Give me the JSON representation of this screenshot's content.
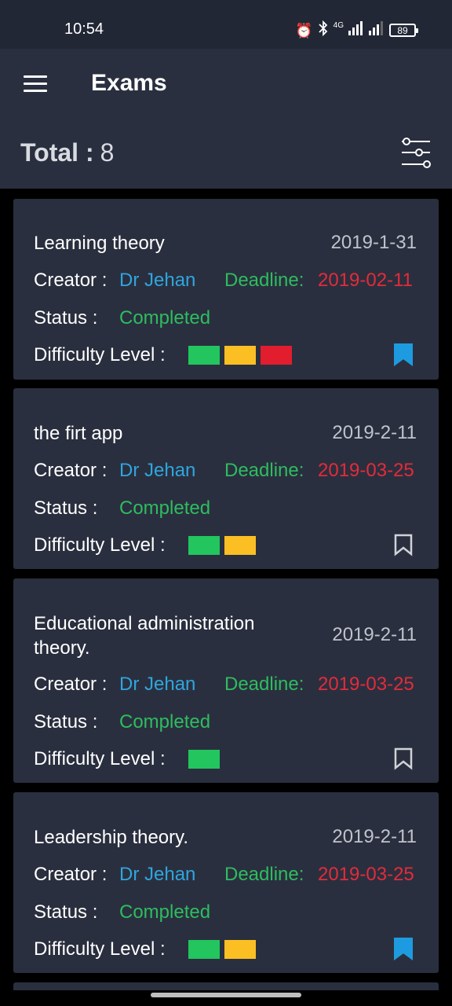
{
  "status_bar": {
    "time": "10:54",
    "network": "4G",
    "battery": "89",
    "icons": [
      "alarm-icon",
      "bluetooth-icon",
      "signal-icon",
      "signal-icon",
      "battery-icon"
    ]
  },
  "header": {
    "title": "Exams",
    "total_label": "Total :",
    "total_value": "8"
  },
  "labels": {
    "creator": "Creator :",
    "deadline": "Deadline:",
    "status": "Status :",
    "difficulty": "Difficulty Level :"
  },
  "colors": {
    "green": "#22c55e",
    "orange": "#fbbf24",
    "red": "#e11d2e",
    "bookmark_active": "#1e9be0",
    "bookmark_inactive": "#cfd2d8"
  },
  "exams": [
    {
      "title": "Learning theory",
      "date": "2019-1-31",
      "creator": "Dr Jehan",
      "deadline": "2019-02-11",
      "status": "Completed",
      "difficulty": [
        "green",
        "orange",
        "red"
      ],
      "bookmarked": true
    },
    {
      "title": "the firt app",
      "date": "2019-2-11",
      "creator": "Dr Jehan",
      "deadline": "2019-03-25",
      "status": "Completed",
      "difficulty": [
        "green",
        "orange"
      ],
      "bookmarked": false
    },
    {
      "title": "Educational administration theory.",
      "date": "2019-2-11",
      "creator": "Dr Jehan",
      "deadline": "2019-03-25",
      "status": "Completed",
      "difficulty": [
        "green"
      ],
      "bookmarked": false
    },
    {
      "title": "Leadership theory.",
      "date": "2019-2-11",
      "creator": "Dr Jehan",
      "deadline": "2019-03-25",
      "status": "Completed",
      "difficulty": [
        "green",
        "orange"
      ],
      "bookmarked": true
    }
  ]
}
